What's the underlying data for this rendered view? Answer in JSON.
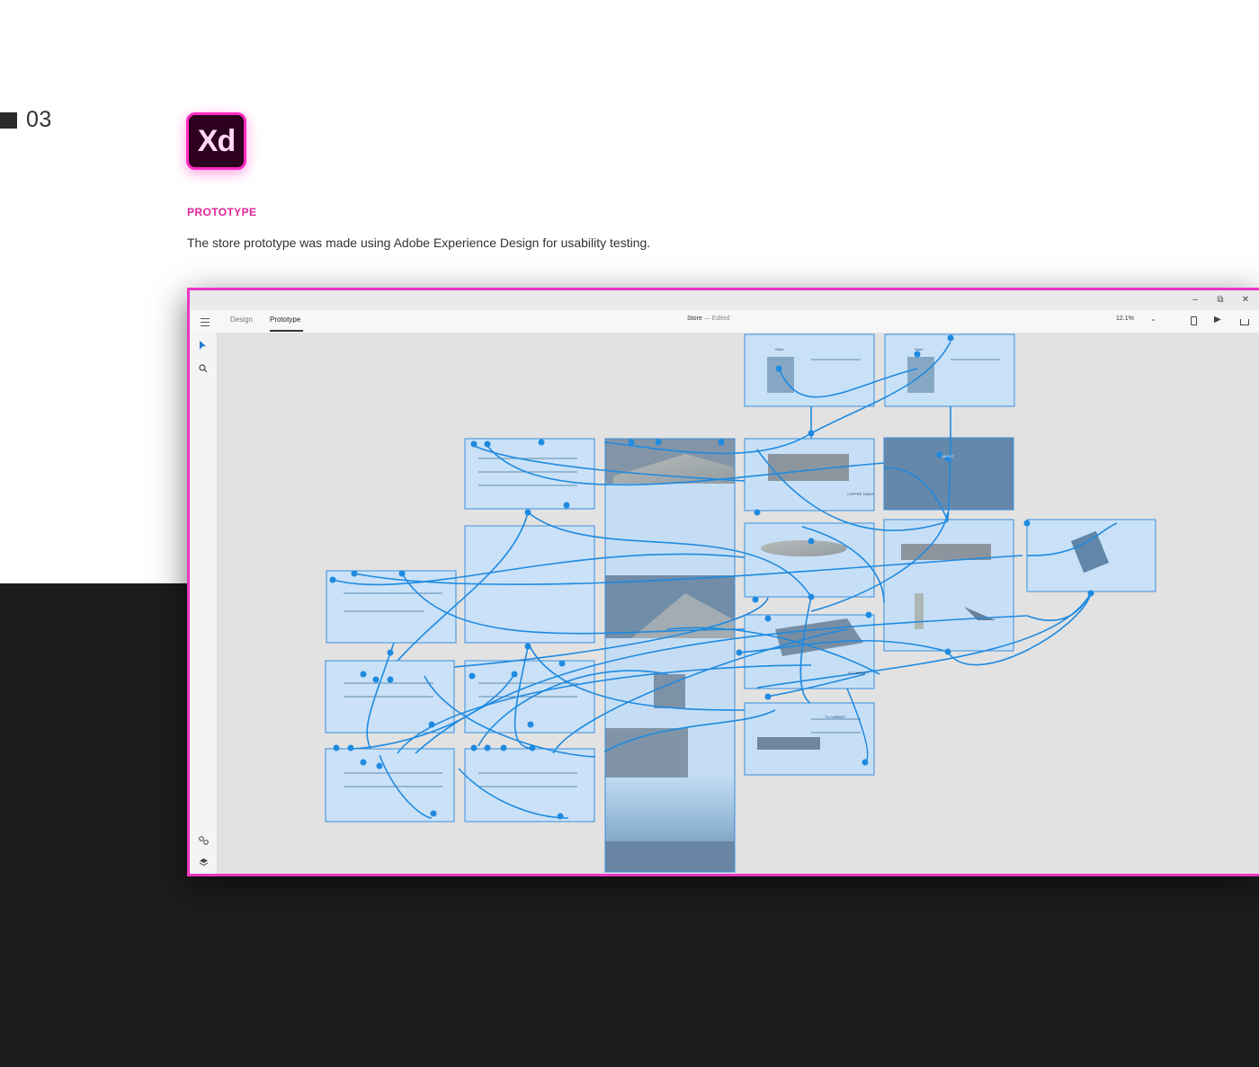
{
  "section": {
    "number": "03"
  },
  "logo": {
    "text": "Xd"
  },
  "heading": "PROTOTYPE",
  "description": "The store prototype was made using Adobe Experience Design for usability testing.",
  "app": {
    "window_controls": {
      "minimize": "–",
      "restore": "⧉",
      "close": "✕"
    },
    "tabs": [
      {
        "label": "Design",
        "active": false
      },
      {
        "label": "Prototype",
        "active": true
      }
    ],
    "document": {
      "name": "Store",
      "separator": "—",
      "status": "Edited"
    },
    "zoom": "12.1%",
    "icons": {
      "menu": "hamburger-icon",
      "zoom_dropdown": "chevron-down-icon",
      "device_preview": "mobile-device-icon",
      "play": "play-icon",
      "share": "share-icon",
      "select_tool": "arrow-select-icon",
      "zoom_tool": "magnifier-icon",
      "assets": "assets-icon",
      "layers": "layers-icon"
    }
  },
  "artboards": [
    {
      "id": "ab1",
      "label": "Store",
      "theme": "light"
    },
    {
      "id": "ab2",
      "label": "Store",
      "theme": "light"
    },
    {
      "id": "ab3",
      "label": "",
      "theme": "light"
    },
    {
      "id": "ab4",
      "label": "",
      "theme": "photo"
    },
    {
      "id": "ab5",
      "label": "COFFEE TABLE",
      "theme": "light"
    },
    {
      "id": "ab6",
      "label": "ABOUT",
      "theme": "dark"
    },
    {
      "id": "ab7",
      "label": "",
      "theme": "light"
    },
    {
      "id": "ab8",
      "label": "",
      "theme": "light"
    },
    {
      "id": "ab9",
      "label": "",
      "theme": "light"
    },
    {
      "id": "ab10",
      "label": "",
      "theme": "light"
    },
    {
      "id": "ab11",
      "label": "",
      "theme": "light"
    },
    {
      "id": "ab12",
      "label": "TV CABINET",
      "theme": "light"
    },
    {
      "id": "ab13",
      "label": "",
      "theme": "light"
    },
    {
      "id": "ab14",
      "label": "TV CABINET",
      "theme": "light"
    },
    {
      "id": "ab15",
      "label": "",
      "theme": "light"
    },
    {
      "id": "ab16",
      "label": "",
      "theme": "light"
    }
  ],
  "colors": {
    "accent": "#e0249a",
    "window_border": "#ee35c4",
    "wire": "#1e8ae0",
    "overlay": "#aad2f8",
    "dark_background": "#1c1c1c"
  }
}
